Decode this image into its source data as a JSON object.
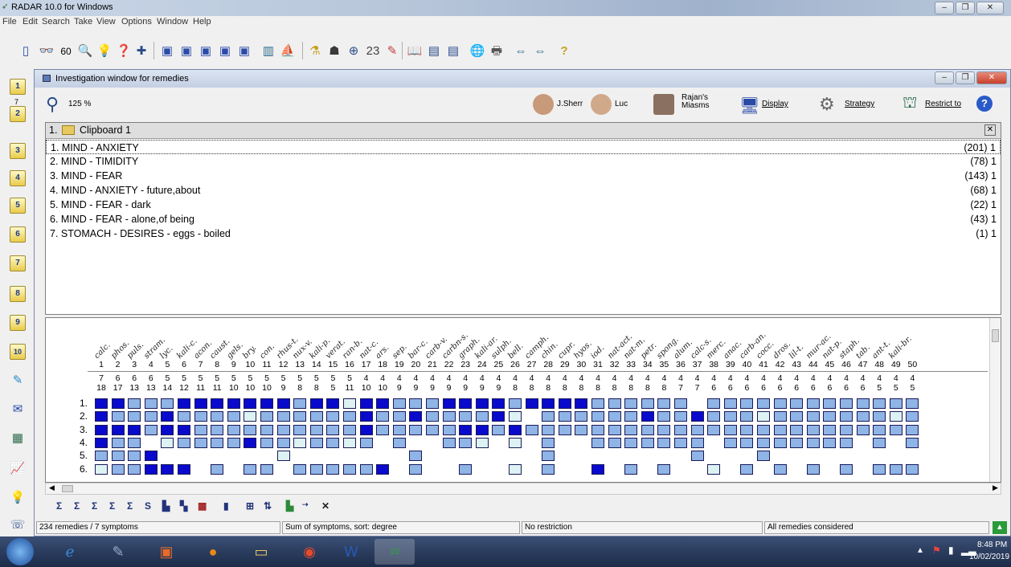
{
  "app": {
    "title": "RADAR 10.0 for Windows",
    "window_buttons": [
      "–",
      "❐",
      "✕"
    ]
  },
  "menu": [
    "File",
    "Edit",
    "Search",
    "Take",
    "View",
    "Options",
    "Window",
    "Help"
  ],
  "window": {
    "title": "Investigation window for remedies",
    "zoom": "125 %",
    "toolbar": {
      "sherr": "J.Sherr",
      "luc": "Luc",
      "rajan_line1": "Rajan's",
      "rajan_line2": "Miasms",
      "display": "Display",
      "strategy": "Strategy",
      "restrict": "Restrict to"
    }
  },
  "left_buttons": [
    "1",
    "2",
    "3",
    "4",
    "5",
    "6",
    "7",
    "8",
    "9",
    "10"
  ],
  "left_button_small": "7",
  "clipboard": {
    "title": "1.",
    "name": "Clipboard 1",
    "close": "✕"
  },
  "symptoms": [
    {
      "text": "1. MIND - ANXIETY",
      "count": "(201) 1"
    },
    {
      "text": "2. MIND - TIMIDITY",
      "count": "(78) 1"
    },
    {
      "text": "3. MIND - FEAR",
      "count": "(143) 1"
    },
    {
      "text": "4. MIND - ANXIETY - future,about",
      "count": "(68) 1"
    },
    {
      "text": "5. MIND - FEAR - dark",
      "count": "(22) 1"
    },
    {
      "text": "6. MIND - FEAR - alone,of being",
      "count": "(43) 1"
    },
    {
      "text": "7. STOMACH - DESIRES - eggs - boiled",
      "count": "(1) 1"
    }
  ],
  "remedies": [
    "calc.",
    "phos.",
    "puls.",
    "stram.",
    "lyc.",
    "kali-c.",
    "acon.",
    "caust.",
    "gels.",
    "bry.",
    "con.",
    "rhus-t.",
    "nux-v.",
    "kali-p.",
    "verat.",
    "ran-b.",
    "nat-c.",
    "ars.",
    "sep.",
    "bar-c.",
    "carb-v.",
    "carbn-s.",
    "graph.",
    "kali-ar.",
    "sulph.",
    "bell.",
    "camph.",
    "chin.",
    "cupr.",
    "hyos.",
    "iod.",
    "nat-act.",
    "nat-m.",
    "petr.",
    "spong.",
    "alum.",
    "calc-s.",
    "merc.",
    "anac.",
    "carb-an.",
    "cocc.",
    "dros.",
    "lil-t.",
    "mur-ac.",
    "nat-p.",
    "staph.",
    "tab.",
    "ant-t.",
    "kali-br."
  ],
  "rank": [
    "1",
    "2",
    "3",
    "4",
    "5",
    "6",
    "7",
    "8",
    "9",
    "10",
    "11",
    "12",
    "13",
    "14",
    "15",
    "16",
    "17",
    "18",
    "19",
    "20",
    "21",
    "22",
    "23",
    "24",
    "25",
    "26",
    "27",
    "28",
    "29",
    "30",
    "31",
    "32",
    "33",
    "34",
    "35",
    "36",
    "37",
    "38",
    "39",
    "40",
    "41",
    "42",
    "43",
    "44",
    "45",
    "46",
    "47",
    "48",
    "49",
    "50"
  ],
  "symptom_counts": [
    "7",
    "6",
    "6",
    "6",
    "5",
    "5",
    "5",
    "5",
    "5",
    "5",
    "5",
    "5",
    "5",
    "5",
    "5",
    "5",
    "4",
    "4",
    "4",
    "4",
    "4",
    "4",
    "4",
    "4",
    "4",
    "4",
    "4",
    "4",
    "4",
    "4",
    "4",
    "4",
    "4",
    "4",
    "4",
    "4",
    "4",
    "4",
    "4",
    "4",
    "4",
    "4",
    "4",
    "4",
    "4",
    "4",
    "4",
    "4",
    "4",
    "4"
  ],
  "degree_sums": [
    "18",
    "17",
    "13",
    "13",
    "14",
    "12",
    "11",
    "11",
    "10",
    "10",
    "10",
    "9",
    "8",
    "8",
    "5",
    "11",
    "10",
    "10",
    "9",
    "9",
    "9",
    "9",
    "9",
    "9",
    "9",
    "8",
    "8",
    "8",
    "8",
    "8",
    "8",
    "8",
    "8",
    "8",
    "8",
    "7",
    "7",
    "6",
    "6",
    "6",
    "6",
    "6",
    "6",
    "6",
    "6",
    "6",
    "6",
    "5",
    "5",
    "5"
  ],
  "grid_rows": [
    "1.",
    "2.",
    "3.",
    "4.",
    "5.",
    "6."
  ],
  "grid_levels": [
    [
      3,
      3,
      2,
      2,
      2,
      3,
      3,
      3,
      3,
      3,
      3,
      3,
      2,
      3,
      3,
      1,
      3,
      3,
      2,
      2,
      2,
      3,
      3,
      3,
      3,
      2,
      3,
      3,
      3,
      3,
      2,
      2,
      2,
      2,
      2,
      2,
      0,
      2,
      2,
      2,
      2,
      2,
      2,
      2,
      2,
      2,
      2,
      2,
      2,
      2
    ],
    [
      3,
      2,
      2,
      2,
      3,
      2,
      2,
      2,
      2,
      1,
      2,
      2,
      2,
      2,
      2,
      2,
      3,
      2,
      2,
      3,
      2,
      2,
      2,
      2,
      3,
      1,
      0,
      2,
      2,
      2,
      2,
      2,
      2,
      3,
      2,
      2,
      3,
      2,
      2,
      2,
      1,
      2,
      2,
      2,
      2,
      2,
      2,
      2,
      1,
      2
    ],
    [
      3,
      3,
      3,
      2,
      3,
      3,
      2,
      2,
      2,
      2,
      2,
      2,
      2,
      2,
      2,
      2,
      3,
      2,
      2,
      2,
      2,
      2,
      3,
      3,
      2,
      3,
      2,
      2,
      2,
      2,
      2,
      2,
      2,
      2,
      2,
      2,
      2,
      2,
      2,
      2,
      2,
      2,
      2,
      2,
      2,
      2,
      2,
      2,
      2,
      2
    ],
    [
      3,
      2,
      2,
      0,
      1,
      2,
      2,
      2,
      2,
      3,
      2,
      2,
      1,
      2,
      2,
      1,
      2,
      0,
      2,
      0,
      0,
      2,
      2,
      1,
      0,
      1,
      0,
      2,
      0,
      0,
      2,
      2,
      2,
      2,
      2,
      2,
      2,
      0,
      2,
      2,
      2,
      2,
      2,
      2,
      2,
      2,
      0,
      2,
      0,
      2
    ],
    [
      2,
      2,
      2,
      3,
      0,
      0,
      0,
      0,
      0,
      0,
      0,
      1,
      0,
      0,
      0,
      0,
      0,
      0,
      0,
      2,
      0,
      0,
      0,
      0,
      0,
      0,
      0,
      2,
      0,
      0,
      0,
      0,
      0,
      0,
      0,
      0,
      2,
      0,
      0,
      0,
      2,
      0,
      0,
      0,
      0,
      0,
      0,
      0,
      0,
      0
    ],
    [
      1,
      2,
      2,
      3,
      3,
      3,
      0,
      2,
      0,
      2,
      2,
      0,
      2,
      2,
      2,
      2,
      2,
      3,
      0,
      2,
      0,
      0,
      2,
      0,
      0,
      1,
      0,
      2,
      0,
      0,
      3,
      0,
      2,
      0,
      2,
      0,
      0,
      1,
      0,
      2,
      0,
      2,
      0,
      2,
      0,
      2,
      0,
      2,
      2,
      2
    ]
  ],
  "status": {
    "left": "234 remedies / 7 symptoms",
    "middle": "Sum of symptoms, sort: degree",
    "restriction": "No restriction",
    "considered": "All remedies considered"
  },
  "taskbar": {
    "time": "8:48 PM",
    "date": "10/02/2019"
  },
  "colors": {
    "degree3": "#0a0acc",
    "degree2": "#8fb4e6",
    "degree1": "#ddf2f2",
    "empty": "#ffffff"
  }
}
